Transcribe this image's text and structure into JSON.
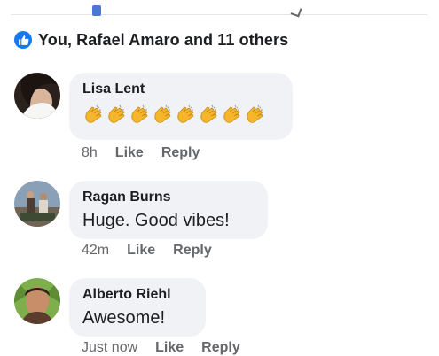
{
  "reactions": {
    "icon": "thumbs-up-icon",
    "summary": "You, Rafael Amaro and 11 others"
  },
  "comments": [
    {
      "author": "Lisa Lent",
      "text_emoji": "clapping-hands-emoji",
      "emoji_count": 8,
      "time": "8h",
      "like_label": "Like",
      "reply_label": "Reply"
    },
    {
      "author": "Ragan Burns",
      "text": "Huge. Good vibes!",
      "time": "42m",
      "like_label": "Like",
      "reply_label": "Reply"
    },
    {
      "author": "Alberto Riehl",
      "text": "Awesome!",
      "time": "Just now",
      "like_label": "Like",
      "reply_label": "Reply"
    }
  ],
  "colors": {
    "accent": "#1877f2",
    "bubble": "#f0f2f5",
    "meta_text": "#65676b",
    "primary_text": "#1c1e21"
  }
}
